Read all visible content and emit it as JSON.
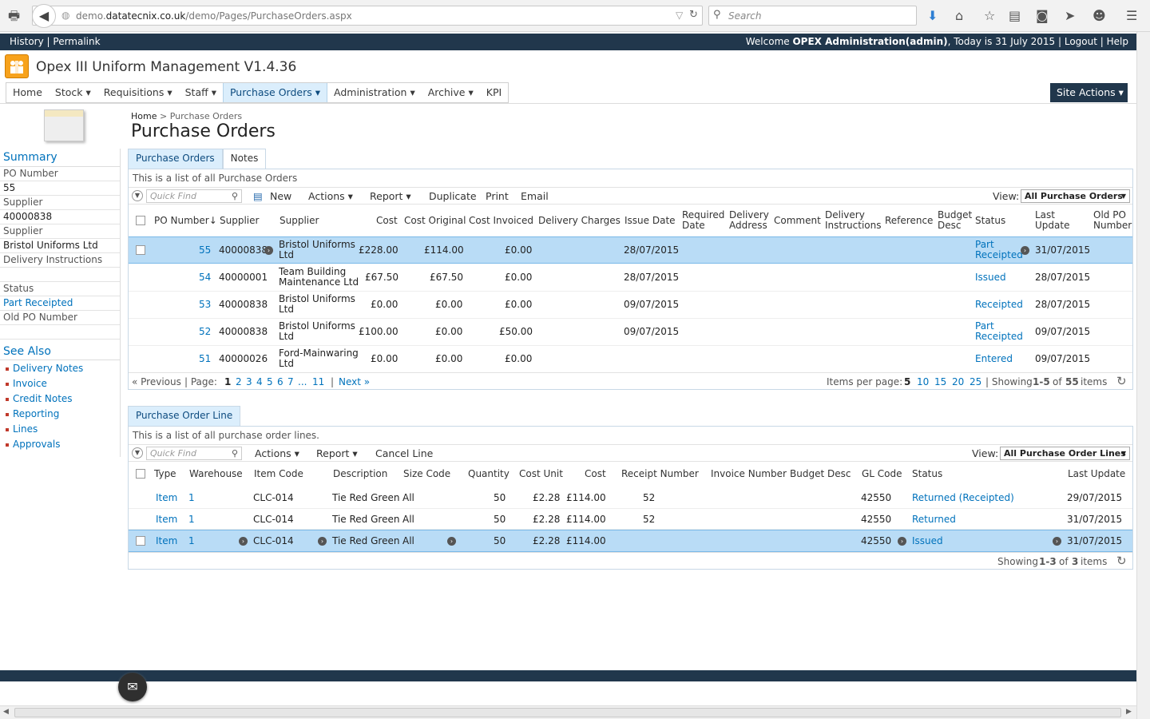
{
  "browser": {
    "url_prefix": "demo.",
    "url_domain": "datatecnix.co.uk",
    "url_path": "/demo/Pages/PurchaseOrders.aspx",
    "search_placeholder": "Search"
  },
  "topbar": {
    "history": "History",
    "permalink": "Permalink",
    "welcome_prefix": "Welcome ",
    "user": "OPEX Administration(admin)",
    "today": ", Today is 31 July 2015",
    "logout": "Logout",
    "help": "Help"
  },
  "app": {
    "title": "Opex III Uniform Management V1.4.36"
  },
  "nav": {
    "items": [
      "Home",
      "Stock ▾",
      "Requisitions ▾",
      "Staff ▾",
      "Purchase Orders ▾",
      "Administration ▾",
      "Archive ▾",
      "KPI"
    ],
    "site_actions": "Site Actions ▾"
  },
  "breadcrumb": {
    "home": "Home",
    "sep": ">",
    "current": "Purchase Orders"
  },
  "page_title": "Purchase Orders",
  "summary": {
    "title": "Summary",
    "rows": [
      "PO Number",
      "55",
      "Supplier",
      "40000838",
      "Supplier",
      "Bristol Uniforms Ltd",
      "Delivery Instructions",
      "",
      "Status",
      "Part Receipted",
      "Old PO Number",
      ""
    ],
    "see_also_title": "See Also",
    "see_also": [
      "Delivery Notes",
      "Invoice",
      "Credit Notes",
      "Reporting",
      "Lines",
      "Approvals"
    ]
  },
  "po": {
    "tabs": [
      "Purchase Orders",
      "Notes"
    ],
    "description": "This is a list of all Purchase Orders",
    "quick_find": "Quick Find",
    "toolbar": {
      "new": "New",
      "actions": "Actions ▾",
      "report": "Report ▾",
      "duplicate": "Duplicate",
      "print": "Print",
      "email": "Email",
      "view_label": "View:",
      "view_value": "All Purchase Orders"
    },
    "headers": {
      "po_number": "PO Number↓",
      "supplier_code": "Supplier",
      "supplier": "Supplier",
      "cost": "Cost",
      "cost_original": "Cost Original",
      "cost_invoiced": "Cost Invoiced",
      "delivery_charges": "Delivery Charges",
      "issue_date": "Issue Date",
      "required_date_1": "Required",
      "required_date_2": "Date",
      "delivery_address_1": "Delivery",
      "delivery_address_2": "Address",
      "comment": "Comment",
      "delivery_instructions_1": "Delivery",
      "delivery_instructions_2": "Instructions",
      "reference": "Reference",
      "budget_desc_1": "Budget",
      "budget_desc_2": "Desc",
      "status": "Status",
      "last_update_1": "Last",
      "last_update_2": "Update",
      "old_po_1": "Old PO",
      "old_po_2": "Number"
    },
    "rows": [
      {
        "po": "55",
        "code": "40000838",
        "sup1": "Bristol Uniforms",
        "sup2": "Ltd",
        "cost": "£228.00",
        "orig": "£114.00",
        "inv": "£0.00",
        "issue": "28/07/2015",
        "st1": "Part",
        "st2": "Receipted",
        "last": "31/07/2015"
      },
      {
        "po": "54",
        "code": "40000001",
        "sup1": "Team Building",
        "sup2": "Maintenance Ltd",
        "cost": "£67.50",
        "orig": "£67.50",
        "inv": "£0.00",
        "issue": "28/07/2015",
        "st1": "Issued",
        "st2": "",
        "last": "28/07/2015"
      },
      {
        "po": "53",
        "code": "40000838",
        "sup1": "Bristol Uniforms",
        "sup2": "Ltd",
        "cost": "£0.00",
        "orig": "£0.00",
        "inv": "£0.00",
        "issue": "09/07/2015",
        "st1": "Receipted",
        "st2": "",
        "last": "28/07/2015"
      },
      {
        "po": "52",
        "code": "40000838",
        "sup1": "Bristol Uniforms",
        "sup2": "Ltd",
        "cost": "£100.00",
        "orig": "£0.00",
        "inv": "£50.00",
        "issue": "09/07/2015",
        "st1": "Part",
        "st2": "Receipted",
        "last": "09/07/2015"
      },
      {
        "po": "51",
        "code": "40000026",
        "sup1": "Ford-Mainwaring",
        "sup2": "Ltd",
        "cost": "£0.00",
        "orig": "£0.00",
        "inv": "£0.00",
        "issue": "",
        "st1": "Entered",
        "st2": "",
        "last": "09/07/2015"
      }
    ],
    "pager": {
      "previous": "« Previous",
      "page_label": "| Page:",
      "pages": [
        "1",
        "2",
        "3",
        "4",
        "5",
        "6",
        "7",
        "...",
        "11"
      ],
      "next": "Next »",
      "ipp_label": "Items per page:",
      "ipp": [
        "5",
        "10",
        "15",
        "20",
        "25"
      ],
      "showing": "| Showing",
      "range": "1-5",
      "of": "of",
      "total": "55",
      "items": "items"
    }
  },
  "pol": {
    "tabs": [
      "Purchase Order Line"
    ],
    "description": "This is a list of all purchase order lines.",
    "quick_find": "Quick Find",
    "toolbar": {
      "actions": "Actions ▾",
      "report": "Report ▾",
      "cancel_line": "Cancel Line",
      "view_label": "View:",
      "view_value": "All Purchase Order Lines"
    },
    "headers": {
      "type": "Type",
      "warehouse": "Warehouse",
      "item_code": "Item Code",
      "description": "Description",
      "size_code": "Size Code",
      "quantity": "Quantity",
      "cost_unit": "Cost Unit",
      "cost": "Cost",
      "receipt_number": "Receipt Number",
      "invoice_number": "Invoice Number",
      "budget_desc": "Budget Desc",
      "gl_code": "GL Code",
      "status": "Status",
      "last_update": "Last Update"
    },
    "rows": [
      {
        "type": "Item",
        "wh": "1",
        "code": "CLC-014",
        "desc": "Tie Red Green",
        "size": "All",
        "qty": "50",
        "unit": "£2.28",
        "cost": "£114.00",
        "receipt": "52",
        "gl": "42550",
        "status": "Returned (Receipted)",
        "last": "29/07/2015"
      },
      {
        "type": "Item",
        "wh": "1",
        "code": "CLC-014",
        "desc": "Tie Red Green",
        "size": "All",
        "qty": "50",
        "unit": "£2.28",
        "cost": "£114.00",
        "receipt": "52",
        "gl": "42550",
        "status": "Returned",
        "last": "31/07/2015"
      },
      {
        "type": "Item",
        "wh": "1",
        "code": "CLC-014",
        "desc": "Tie Red Green",
        "size": "All",
        "qty": "50",
        "unit": "£2.28",
        "cost": "£114.00",
        "receipt": "",
        "gl": "42550",
        "status": "Issued",
        "last": "31/07/2015"
      }
    ],
    "footer": {
      "showing": "Showing",
      "range": "1-3",
      "of": "of",
      "total": "3",
      "items": "items"
    }
  },
  "colors": {
    "dark_bar": "#21374c",
    "selected_row": "#b9dcf6",
    "link": "#0072bc",
    "logo": "#f7a21c"
  }
}
